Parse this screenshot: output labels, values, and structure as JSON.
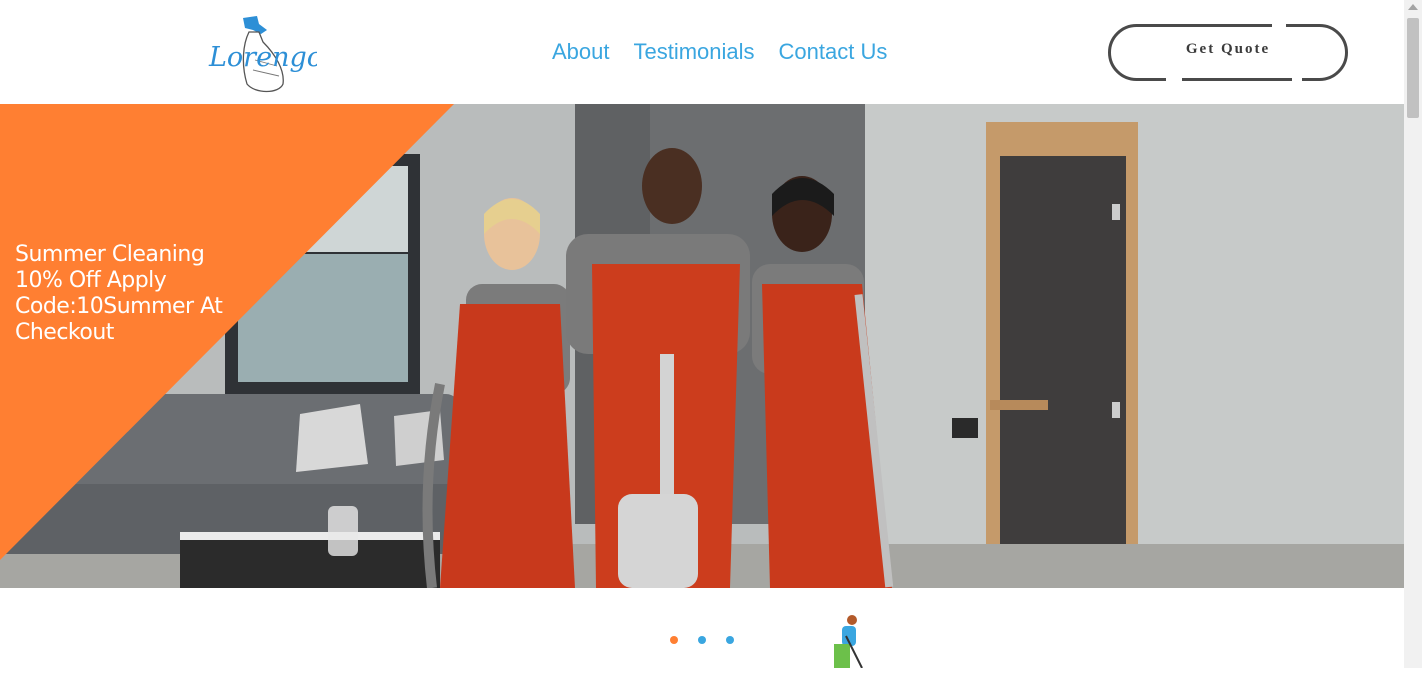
{
  "brand": {
    "logo_text": "Lorengos"
  },
  "nav": {
    "items": [
      "About",
      "Testimonials",
      "Contact Us"
    ]
  },
  "header": {
    "cta_label": "Get Quote"
  },
  "hero": {
    "promo_text": "Summer Cleaning 10% Off Apply Code:10Summer At Checkout",
    "image_icon": "cleaning-team-photo"
  },
  "slider": {
    "dot_count": 3,
    "active_index": 0
  },
  "colors": {
    "accent_blue": "#3aa6e0",
    "promo_orange": "#ff7f32",
    "button_border": "#4a4a4a"
  }
}
